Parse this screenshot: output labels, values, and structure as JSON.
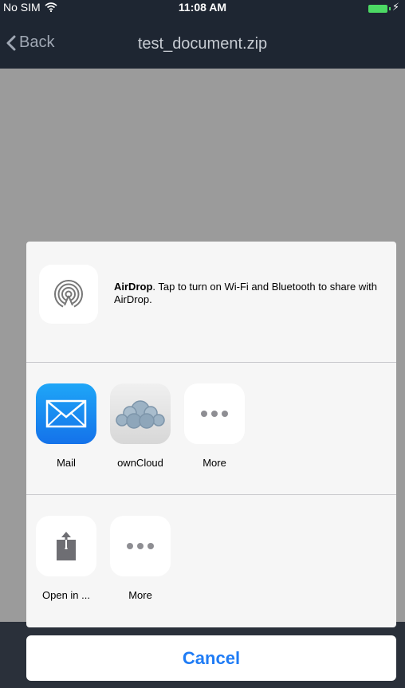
{
  "status_bar": {
    "carrier": "No SIM",
    "time": "11:08 AM",
    "charging_symbol": "⚡"
  },
  "nav": {
    "back_label": "Back",
    "title": "test_document.zip"
  },
  "share_sheet": {
    "airdrop": {
      "title": "AirDrop",
      "description": ". Tap to turn on Wi-Fi and Bluetooth to share with AirDrop."
    },
    "apps": [
      {
        "label": "Mail",
        "icon": "mail-icon"
      },
      {
        "label": "ownCloud",
        "icon": "owncloud-icon"
      },
      {
        "label": "More",
        "icon": "more-dots-icon"
      }
    ],
    "actions": [
      {
        "label": "Open in ...",
        "icon": "open-in-icon"
      },
      {
        "label": "More",
        "icon": "more-dots-icon"
      }
    ]
  },
  "cancel_label": "Cancel",
  "colors": {
    "nav_background": "#1e2632",
    "accent_blue": "#1f7cf5",
    "battery_green": "#4cd964"
  }
}
